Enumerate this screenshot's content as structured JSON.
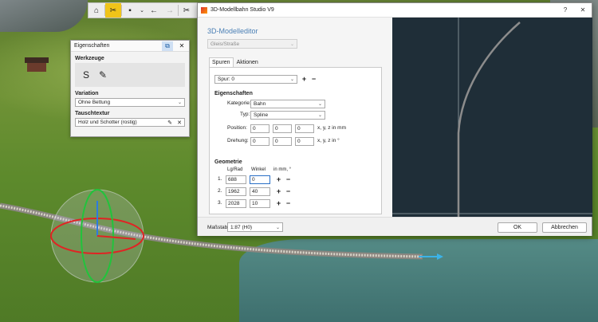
{
  "toolbar": {
    "icons": [
      "home-icon",
      "tools-icon",
      "save-icon",
      "chevron-down-icon",
      "back-arrow-icon",
      "forward-arrow-icon",
      "scissors-icon"
    ]
  },
  "properties_panel": {
    "title": "Eigenschaften",
    "tools_heading": "Werkzeuge",
    "variation_heading": "Variation",
    "variation_value": "Ohne Bettung",
    "texture_heading": "Tauschtextur",
    "texture_value": "Holz und Schotter (rostig)"
  },
  "dialog": {
    "window_title": "3D-Modellbahn Studio V9",
    "help_label": "?",
    "editor_title": "3D-Modelleditor",
    "category_select": "Gleis/Straße",
    "tabs": [
      {
        "label": "Spuren",
        "active": true
      },
      {
        "label": "Aktionen",
        "active": false
      }
    ],
    "track_select": "Spur: 0",
    "properties_heading": "Eigenschaften",
    "kategorie_label": "Kategorie:",
    "kategorie_value": "Bahn",
    "typ_label": "Typ:",
    "typ_value": "Spline",
    "position_label": "Position:",
    "position_values": [
      "0",
      "0",
      "0"
    ],
    "position_unit": "x, y, z in mm",
    "rotation_label": "Drehung:",
    "rotation_values": [
      "0",
      "0",
      "0"
    ],
    "rotation_unit": "x, y, z in °",
    "geometry_heading": "Geometrie",
    "geometry_col1": "Lg/Rad",
    "geometry_col2": "Winkel",
    "geometry_col3": "in mm, °",
    "geometry_rows": [
      {
        "index": "1.",
        "length": "688",
        "angle": "0"
      },
      {
        "index": "2.",
        "length": "1962",
        "angle": "40"
      },
      {
        "index": "3.",
        "length": "2028",
        "angle": "10"
      }
    ],
    "scale_label": "Maßstab:",
    "scale_value": "1:87 (H0)",
    "ok_label": "OK",
    "cancel_label": "Abbrechen"
  },
  "colors": {
    "preview_bg": "#1f2e38",
    "accent": "#4a7fb5",
    "active_tool": "#f0c419"
  }
}
